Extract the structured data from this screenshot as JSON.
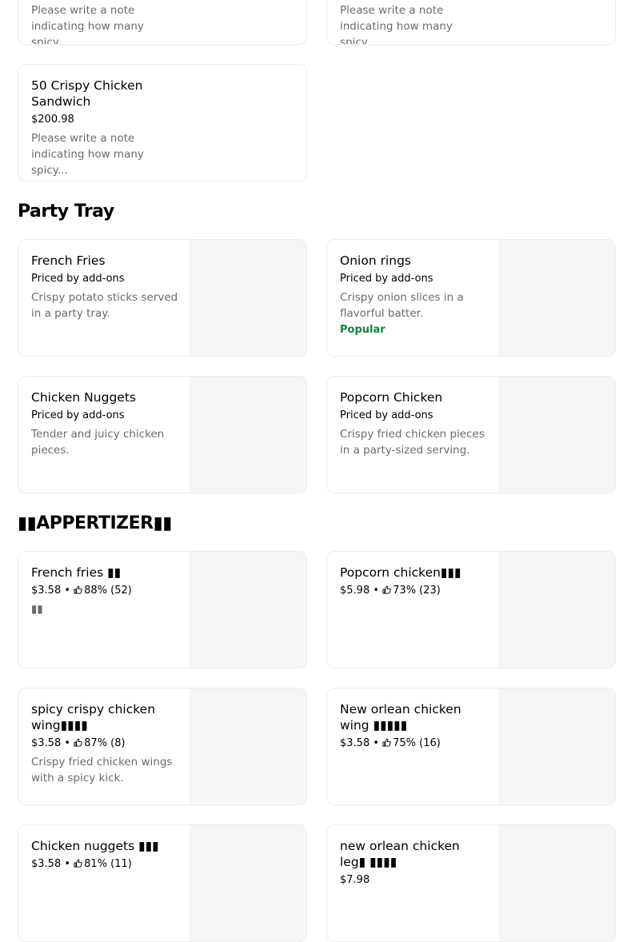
{
  "top_cards": [
    {
      "desc": "Please write a note indicating how many spicy..."
    },
    {
      "desc": "Please write a note indicating how many spicy..."
    }
  ],
  "sandwich_card": {
    "name": "50 Crispy Chicken Sandwich",
    "price": "$200.98",
    "desc": "Please write a note indicating how many spicy..."
  },
  "party_tray": {
    "title": "Party Tray",
    "items": [
      {
        "name": "French Fries",
        "price": "Priced by add-ons",
        "desc": "Crispy potato sticks served in a party tray.",
        "tag": ""
      },
      {
        "name": "Onion rings",
        "price": "Priced by add-ons",
        "desc": "Crispy onion slices in a flavorful batter.",
        "tag": "Popular"
      },
      {
        "name": "Chicken Nuggets",
        "price": "Priced by add-ons",
        "desc": "Tender and juicy chicken pieces.",
        "tag": ""
      },
      {
        "name": "Popcorn Chicken",
        "price": "Priced by add-ons",
        "desc": "Crispy fried chicken pieces in a party-sized serving.",
        "tag": ""
      }
    ]
  },
  "appetizer": {
    "title": "▮▮APPERTIZER▮▮",
    "items": [
      {
        "name": "French fries ▮▮",
        "price": "$3.58",
        "rating": "88% (52)",
        "desc": "▮▮"
      },
      {
        "name": "Popcorn chicken▮▮▮",
        "price": "$5.98",
        "rating": "73% (23)",
        "desc": ""
      },
      {
        "name": "spicy crispy chicken wing▮▮▮▮",
        "price": "$3.58",
        "rating": "87% (8)",
        "desc": "Crispy fried chicken wings with a spicy kick."
      },
      {
        "name": "New orlean chicken wing ▮▮▮▮▮",
        "price": "$3.58",
        "rating": "75% (16)",
        "desc": ""
      },
      {
        "name": "Chicken nuggets ▮▮▮",
        "price": "$3.58",
        "rating": "81% (11)",
        "desc": ""
      },
      {
        "name": "new orlean chicken leg▮ ▮▮▮▮",
        "price": "$7.98",
        "rating": "",
        "desc": ""
      }
    ]
  },
  "separator": " • ",
  "colors": {
    "popular": "#0e8345",
    "muted": "#6b6b6b",
    "border": "#ececec",
    "thumb": "#f6f6f6"
  }
}
